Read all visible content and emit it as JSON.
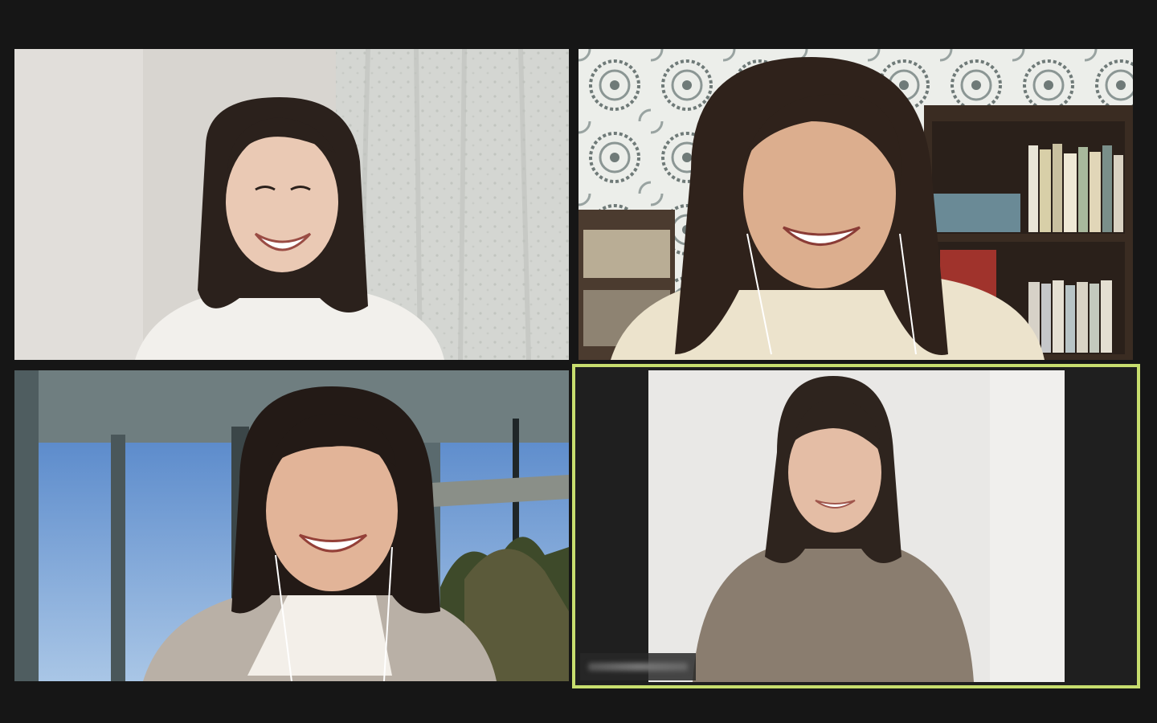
{
  "meeting": {
    "view_mode": "gallery-view",
    "active_speaker_index": 4,
    "colors": {
      "background": "#161616",
      "active_speaker_border": "#c7dd6e"
    }
  },
  "participants": [
    {
      "id": "participant-1",
      "name": ""
    },
    {
      "id": "participant-2",
      "name": ""
    },
    {
      "id": "participant-3",
      "name": ""
    },
    {
      "id": "participant-4",
      "name": ""
    }
  ]
}
